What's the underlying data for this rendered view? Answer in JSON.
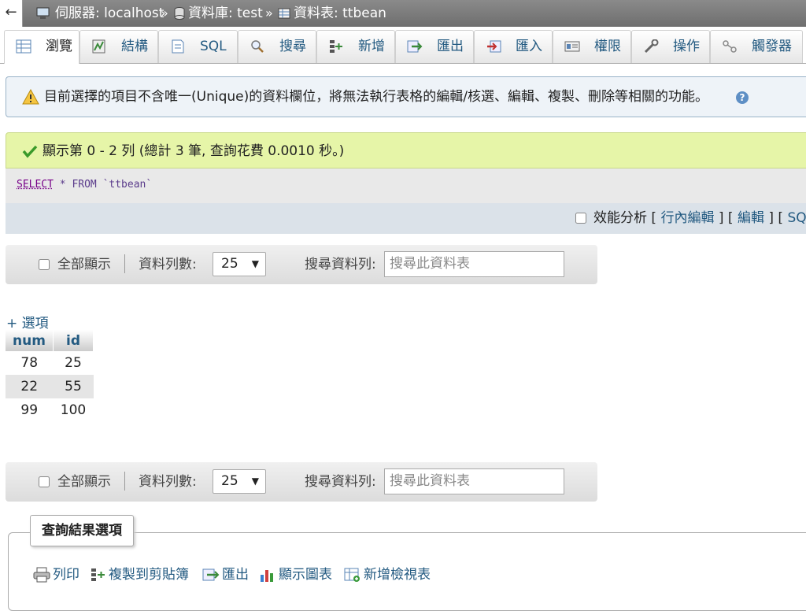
{
  "breadcrumb": {
    "back": "←",
    "server": "伺服器: localhost",
    "database": "資料庫: test",
    "table": "資料表: ttbean",
    "separator": "»"
  },
  "tabs": [
    {
      "label": "瀏覽",
      "icon": "browse-icon",
      "active": true
    },
    {
      "label": "結構",
      "icon": "structure-icon"
    },
    {
      "label": "SQL",
      "icon": "sql-icon"
    },
    {
      "label": "搜尋",
      "icon": "search-icon"
    },
    {
      "label": "新增",
      "icon": "insert-icon"
    },
    {
      "label": "匯出",
      "icon": "export-icon"
    },
    {
      "label": "匯入",
      "icon": "import-icon"
    },
    {
      "label": "權限",
      "icon": "privileges-icon"
    },
    {
      "label": "操作",
      "icon": "operations-icon"
    },
    {
      "label": "觸發器",
      "icon": "triggers-icon"
    }
  ],
  "warning": {
    "text": "目前選擇的項目不含唯一(Unique)的資料欄位，將無法執行表格的編輯/核選、編輯、複製、刪除等相關的功能。",
    "help_icon": "?"
  },
  "success": {
    "text": "顯示第 0 - 2 列 (總計 3 筆, 查詢花費 0.0010 秒。)"
  },
  "sql": {
    "keyword": "SELECT",
    "rest": " * FROM `ttbean`"
  },
  "sql_tools": {
    "profiling": "效能分析",
    "bracket_open": "[",
    "bracket_close": "]",
    "inline_edit": "行內編輯",
    "edit": "編輯",
    "sql": "SQL"
  },
  "navigation": {
    "show_all": "全部顯示",
    "rows_label": "資料列數:",
    "rows_value": "25",
    "search_label": "搜尋資料列:",
    "search_placeholder": "搜尋此資料表"
  },
  "options_link": "+ 選項",
  "table": {
    "columns": [
      "num",
      "id"
    ],
    "rows": [
      [
        "78",
        "25"
      ],
      [
        "22",
        "55"
      ],
      [
        "99",
        "100"
      ]
    ]
  },
  "result_ops": {
    "legend": "查詢結果選項",
    "print": "列印",
    "copy": "複製到剪貼簿",
    "export": "匯出",
    "chart": "顯示圖表",
    "create_view": "新增檢視表"
  },
  "colors": {
    "link": "#235a81",
    "warning_bg": "#eef3f8",
    "success_bg": "#e6f5a8",
    "topbar": "#7a7a7a"
  }
}
